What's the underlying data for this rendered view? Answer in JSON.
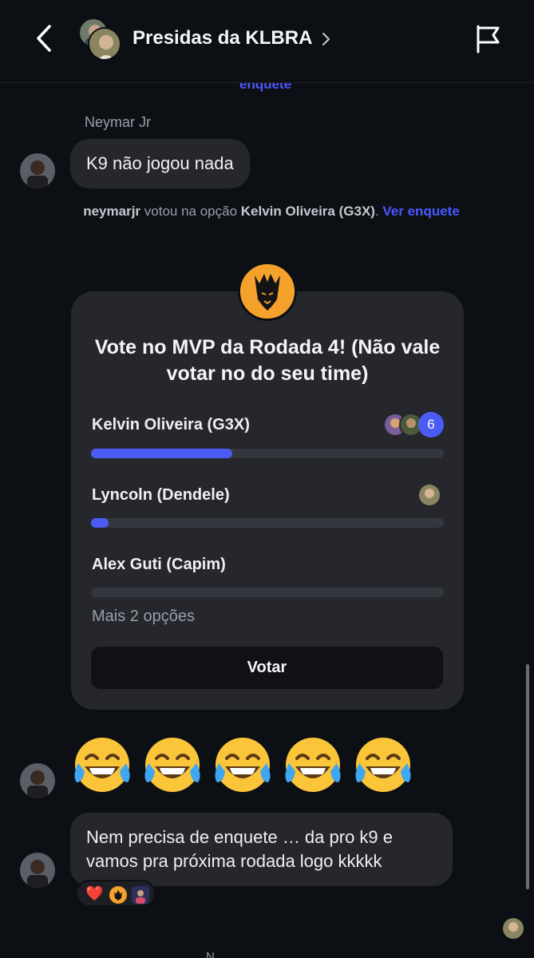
{
  "header": {
    "title": "Presidas da KLBRA",
    "back_icon": "chevron-left-icon",
    "info_icon": "chevron-right-icon",
    "report_icon": "flag-icon"
  },
  "previous_link": "enquete",
  "messages": [
    {
      "sender": "Neymar Jr",
      "text": "K9 não jogou nada"
    }
  ],
  "system_notice": {
    "user": "neymarjr",
    "text": " votou na opção ",
    "option": "Kelvin Oliveira (G3X)",
    "suffix": ". ",
    "link": "Ver enquete"
  },
  "poll": {
    "title": "Vote no MVP da Rodada 4! (Não vale votar no do seu time)",
    "options": [
      {
        "label": "Kelvin Oliveira (G3X)",
        "fraction": 0.4,
        "count": "6"
      },
      {
        "label": "Lyncoln (Dendele)",
        "fraction": 0.05
      },
      {
        "label": "Alex Guti (Capim)",
        "fraction": 0.0
      }
    ],
    "more_options": "Mais 2 opções",
    "vote_button": "Votar"
  },
  "emoji_message": "😂😂😂😂😂",
  "last_message": {
    "text": "Nem precisa de enquete … da pro k9 e vamos pra próxima rodada logo kkkkk",
    "reactions": [
      "❤️"
    ]
  },
  "bottom_text": "N",
  "colors": {
    "accent": "#4b5cf5",
    "link": "#4a5aff",
    "bubble": "#25272d",
    "background": "#0c0f14",
    "logo": "#f5a22d"
  }
}
